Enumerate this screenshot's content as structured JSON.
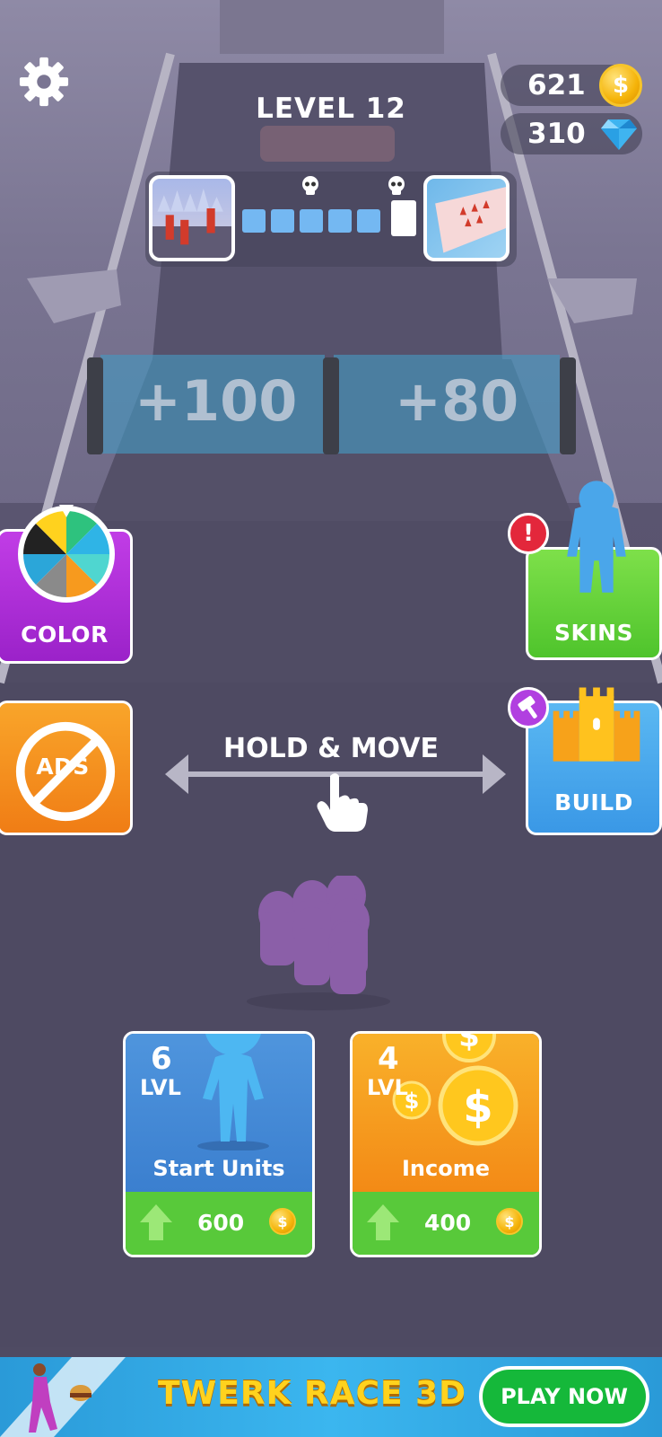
{
  "hud": {
    "level": "LEVEL 12",
    "coins": "621",
    "gems": "310",
    "coin_symbol": "$"
  },
  "progress": {
    "steps_total": 6,
    "steps_done": 5
  },
  "gates": {
    "left": "+100",
    "right": "+80"
  },
  "side_buttons": {
    "color": "COLOR",
    "skins": "SKINS",
    "ads": "ADS",
    "build": "BUILD"
  },
  "hint": "HOLD & MOVE",
  "upgrades": [
    {
      "level": "6",
      "lvl_label": "LVL",
      "name": "Start Units",
      "price": "600"
    },
    {
      "level": "4",
      "lvl_label": "LVL",
      "name": "Income",
      "price": "400"
    }
  ],
  "ad": {
    "title": "TWERK RACE 3D",
    "button": "PLAY NOW"
  },
  "colors": {
    "purple": "#b42ee0",
    "orange": "#f7931e",
    "green": "#5ed13a",
    "blue": "#4aa6ea",
    "crowd": "#8b5fa8"
  }
}
